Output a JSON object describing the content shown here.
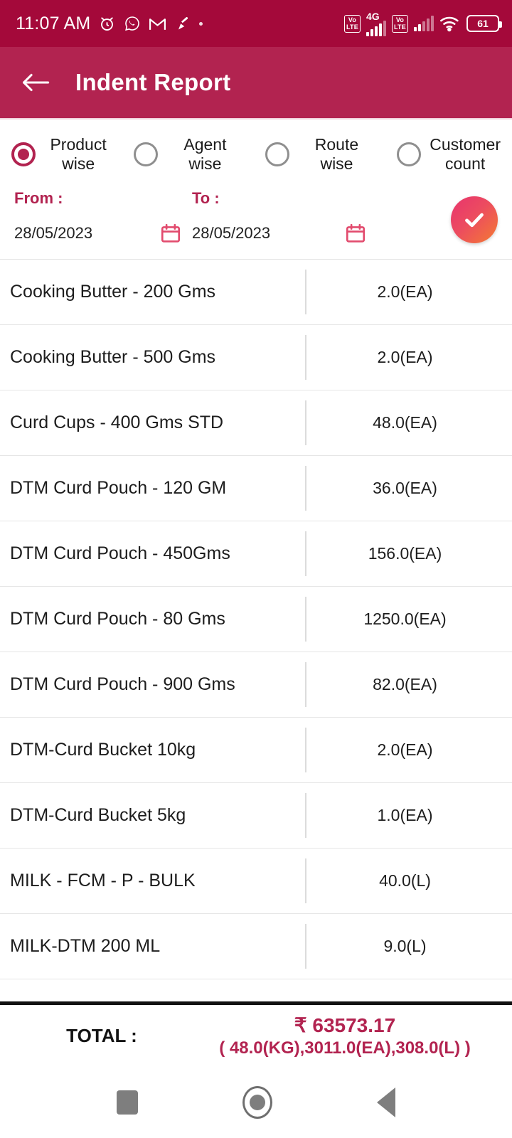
{
  "statusbar": {
    "time": "11:07 AM",
    "icons": [
      "alarm-icon",
      "whatsapp-icon",
      "gmail-icon",
      "cleaner-icon",
      "dot-icon"
    ],
    "sim1_badge_top": "Vo",
    "sim1_badge_bottom": "LTE",
    "network_label": "4G",
    "sim2_badge_top": "Vo",
    "sim2_badge_bottom": "LTE",
    "battery": "61"
  },
  "appbar": {
    "title": "Indent Report",
    "back_icon": "arrow-left-icon",
    "background": "#b22350"
  },
  "filters": {
    "options": [
      {
        "label": "Product wise",
        "selected": true
      },
      {
        "label": "Agent wise",
        "selected": false
      },
      {
        "label": "Route wise",
        "selected": false
      },
      {
        "label": "Customer count",
        "selected": false
      }
    ],
    "from_label": "From :",
    "from_value": "28/05/2023",
    "to_label": "To :",
    "to_value": "28/05/2023",
    "submit_icon": "check-icon",
    "calendar_icon": "calendar-icon",
    "accent": "#b22350"
  },
  "list": {
    "rows": [
      {
        "name": "Cooking Butter - 200 Gms",
        "qty": "2.0(EA)"
      },
      {
        "name": "Cooking Butter - 500 Gms",
        "qty": "2.0(EA)"
      },
      {
        "name": "Curd Cups - 400 Gms STD",
        "qty": "48.0(EA)"
      },
      {
        "name": "DTM Curd Pouch - 120 GM",
        "qty": "36.0(EA)"
      },
      {
        "name": "DTM Curd Pouch - 450Gms",
        "qty": "156.0(EA)"
      },
      {
        "name": "DTM Curd Pouch - 80 Gms",
        "qty": "1250.0(EA)"
      },
      {
        "name": "DTM Curd Pouch - 900 Gms",
        "qty": "82.0(EA)"
      },
      {
        "name": "DTM-Curd Bucket 10kg",
        "qty": "2.0(EA)"
      },
      {
        "name": "DTM-Curd Bucket 5kg",
        "qty": "1.0(EA)"
      },
      {
        "name": "MILK - FCM - P - BULK",
        "qty": "40.0(L)"
      },
      {
        "name": "MILK-DTM 200 ML",
        "qty": "9.0(L)"
      }
    ]
  },
  "total": {
    "label": "TOTAL :",
    "amount": "₹ 63573.17",
    "units": "( 48.0(KG),3011.0(EA),308.0(L) )",
    "color": "#b22350"
  },
  "navbar": {
    "recents": "square-icon",
    "home": "circle-icon",
    "back": "triangle-back-icon"
  }
}
